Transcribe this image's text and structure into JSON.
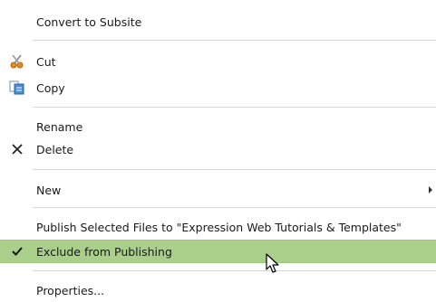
{
  "menu": {
    "items": [
      {
        "label": "Convert to Subsite"
      },
      {
        "label": "Cut",
        "icon": "scissors-icon"
      },
      {
        "label": "Copy",
        "icon": "copy-icon"
      },
      {
        "label": "Rename"
      },
      {
        "label": "Delete",
        "icon": "delete-x-icon"
      },
      {
        "label": "New",
        "has_submenu": true
      },
      {
        "label": "Publish Selected Files to \"Expression Web Tutorials & Templates\""
      },
      {
        "label": "Exclude from Publishing",
        "icon": "checkmark-icon",
        "checked": true,
        "highlighted": true
      },
      {
        "label": "Properties..."
      }
    ],
    "highlight_color": "#a9cf8a"
  }
}
